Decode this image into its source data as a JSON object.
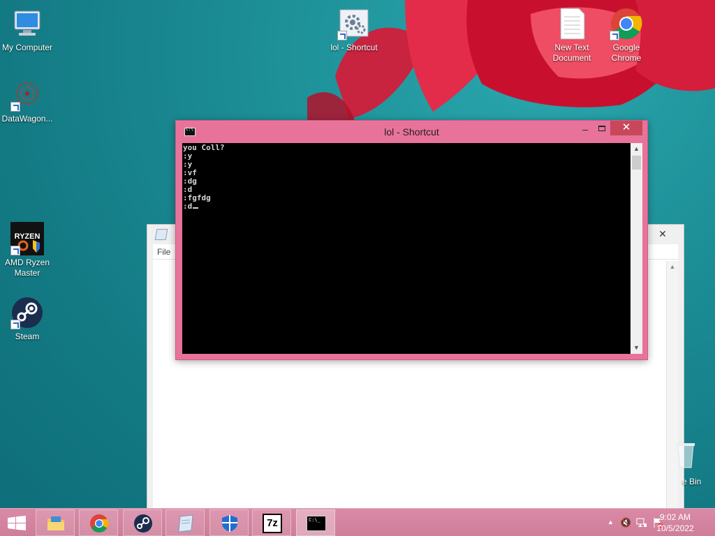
{
  "desktop": {
    "icons": [
      {
        "label": "My Computer"
      },
      {
        "label": "DataWagon..."
      },
      {
        "label": "AMD Ryzen Master"
      },
      {
        "label": "Steam"
      },
      {
        "label": "lol - Shortcut"
      },
      {
        "label": "New Text Document"
      },
      {
        "label": "Google Chrome"
      },
      {
        "label": "e Bin"
      }
    ]
  },
  "background_window": {
    "menu_file": "File",
    "close_glyph": "✕"
  },
  "cmd_window": {
    "title": "lol - Shortcut",
    "minimize_glyph": "–",
    "close_glyph": "✕",
    "lines": [
      "you Coll?",
      ":y",
      ":y",
      ":vf",
      ":dg",
      ":d",
      ":fgfdg",
      ":d"
    ],
    "scroll_up": "▲",
    "scroll_down": "▼"
  },
  "taskbar": {
    "apps": [
      {
        "name": "File Explorer",
        "icon": "folder-icon"
      },
      {
        "name": "Google Chrome",
        "icon": "chrome-icon"
      },
      {
        "name": "Steam",
        "icon": "steam-icon"
      },
      {
        "name": "Notepad",
        "icon": "notepad-icon"
      },
      {
        "name": "Windows Defender",
        "icon": "shield-icon"
      },
      {
        "name": "7-Zip",
        "icon": "7z-icon",
        "text": "7z"
      },
      {
        "name": "Command Prompt",
        "icon": "cmd-icon",
        "active": true
      }
    ],
    "tray_arrow": "▲",
    "time": "9:02 AM",
    "date": "10/5/2022"
  },
  "colors": {
    "taskbar": "#d98aa6",
    "cmd_frame": "#e8739a",
    "close_button": "#c9475a"
  }
}
